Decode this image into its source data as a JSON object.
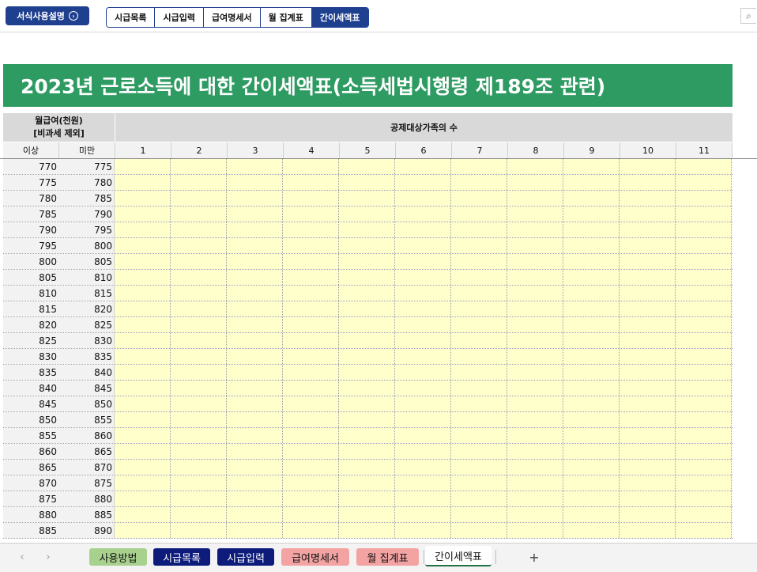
{
  "topbar": {
    "help_button": "서식사용설명",
    "help_glyph": "›",
    "nav_tabs": [
      "시급목록",
      "시급입력",
      "급여명세서",
      "월 집계표",
      "간이세액표"
    ],
    "active_nav": "간이세액표"
  },
  "title": "2023년 근로소득에 대한 간이세액표(소득세법시행령 제189조 관련)",
  "table": {
    "monthly_pay_label": "월급여(천원)",
    "excl_label": "[비과세 제외]",
    "family_label": "공제대상가족의 수",
    "col_from": "이상",
    "col_to": "미만",
    "family_columns": [
      "1",
      "2",
      "3",
      "4",
      "5",
      "6",
      "7",
      "8",
      "9",
      "10",
      "11"
    ],
    "rows": [
      [
        "770",
        "775"
      ],
      [
        "775",
        "780"
      ],
      [
        "780",
        "785"
      ],
      [
        "785",
        "790"
      ],
      [
        "790",
        "795"
      ],
      [
        "795",
        "800"
      ],
      [
        "800",
        "805"
      ],
      [
        "805",
        "810"
      ],
      [
        "810",
        "815"
      ],
      [
        "815",
        "820"
      ],
      [
        "820",
        "825"
      ],
      [
        "825",
        "830"
      ],
      [
        "830",
        "835"
      ],
      [
        "835",
        "840"
      ],
      [
        "840",
        "845"
      ],
      [
        "845",
        "850"
      ],
      [
        "850",
        "855"
      ],
      [
        "855",
        "860"
      ],
      [
        "860",
        "865"
      ],
      [
        "865",
        "870"
      ],
      [
        "870",
        "875"
      ],
      [
        "875",
        "880"
      ],
      [
        "880",
        "885"
      ],
      [
        "885",
        "890"
      ]
    ]
  },
  "sheet_tabs": {
    "tabs": [
      {
        "label": "사용방법",
        "color": "green"
      },
      {
        "label": "시급목록",
        "color": "navy"
      },
      {
        "label": "시급입력",
        "color": "navy"
      },
      {
        "label": "급여명세서",
        "color": "pink"
      },
      {
        "label": "월 집계표",
        "color": "pink"
      },
      {
        "label": "간이세액표",
        "color": "current"
      }
    ],
    "add_label": "+",
    "prev_label": "‹",
    "next_label": "›"
  },
  "colors": {
    "banner_bg": "#2e9b62",
    "brand_navy": "#1f3f8f",
    "cell_bg": "#ffffcc"
  }
}
